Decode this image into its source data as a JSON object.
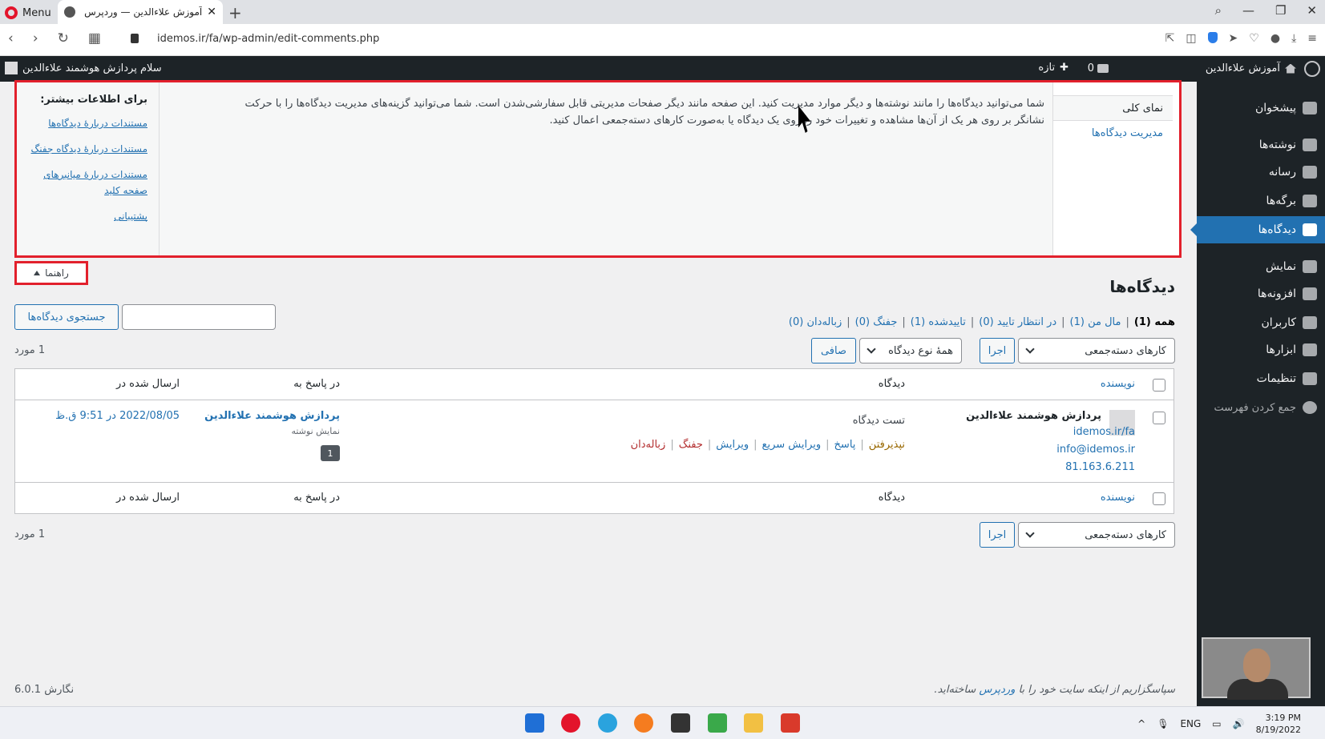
{
  "browser": {
    "menu_label": "Menu",
    "tab_title": "آموزش علاءالدین — وردپرس",
    "url": "idemos.ir/fa/wp-admin/edit-comments.php"
  },
  "adminbar": {
    "site_name": "آموزش علاءالدین",
    "comments_count": "0",
    "new_label": "تازه",
    "howdy": "سلام پردازش هوشمند علاءالدین"
  },
  "sidebar": {
    "items": [
      {
        "label": "پیشخوان",
        "icon": "dashboard-icon"
      },
      {
        "label": "نوشته‌ها",
        "icon": "pin-icon"
      },
      {
        "label": "رسانه",
        "icon": "media-icon"
      },
      {
        "label": "برگه‌ها",
        "icon": "pages-icon"
      },
      {
        "label": "دیدگاه‌ها",
        "icon": "comments-icon",
        "active": true
      },
      {
        "label": "نمایش",
        "icon": "appearance-icon"
      },
      {
        "label": "افزونه‌ها",
        "icon": "plugins-icon"
      },
      {
        "label": "کاربران",
        "icon": "users-icon"
      },
      {
        "label": "ابزارها",
        "icon": "tools-icon"
      },
      {
        "label": "تنظیمات",
        "icon": "settings-icon"
      },
      {
        "label": "جمع کردن فهرست",
        "icon": "collapse-icon"
      }
    ]
  },
  "help": {
    "tab_overview": "نمای کلی",
    "tab_manage": "مدیریت دیدگاه‌ها",
    "content": "شما می‌توانید دیدگاه‌ها را مانند نوشته‌ها و دیگر موارد مدیریت کنید. این صفحه مانند دیگر صفحات مدیریتی قابل سفارشی‌شدن است. شما می‌توانید گزینه‌های مدیریت دیدگاه‌ها را با حرکت نشانگر بر روی هر یک از آن‌ها مشاهده و تغییرات خود را روی یک دیدگاه یا به‌صورت کارهای دسته‌جمعی اعمال کنید.",
    "sidebar_title": "برای اطلاعات بیشتر:",
    "links": [
      "مستندات دربارهٔ دیدگاه‌ها",
      "مستندات دربارهٔ دیدگاه جفنگ",
      "مستندات دربارهٔ میانبرهای صفحه کلید",
      "پشتیبانی"
    ],
    "toggle_label": "راهنما"
  },
  "page": {
    "title": "دیدگاه‌ها",
    "filters": [
      {
        "label": "همه",
        "count": "(1)",
        "current": true
      },
      {
        "label": "مال من",
        "count": "(1)"
      },
      {
        "label": "در انتظار تایید",
        "count": "(0)"
      },
      {
        "label": "تاییدشده",
        "count": "(1)"
      },
      {
        "label": "جفنگ",
        "count": "(0)"
      },
      {
        "label": "زباله‌دان",
        "count": "(0)"
      }
    ],
    "search_button": "جستجوی دیدگاه‌ها",
    "search_placeholder": "",
    "bulk_actions": "کارهای دسته‌جمعی",
    "apply": "اجرا",
    "comment_type": "همهٔ نوع دیدگاه",
    "filter_button": "صافی",
    "items_count": "1 مورد"
  },
  "table": {
    "headers": {
      "author": "نویسنده",
      "comment": "دیدگاه",
      "response": "در پاسخ به",
      "submitted": "ارسال شده در"
    },
    "row": {
      "author_name": "پردازش هوشمند علاءالدین",
      "author_url": "idemos.ir/fa",
      "author_email": "info@idemos.ir",
      "author_ip": "81.163.6.211",
      "comment": "تست دیدگاه",
      "actions": [
        "نپذیرفتن",
        "پاسخ",
        "ویرایش سریع",
        "ویرایش",
        "جفنگ",
        "زباله‌دان"
      ],
      "response_to": "پردازش هوشمند علاءالدین",
      "view_post": "نمایش نوشته",
      "comment_count": "1",
      "submitted_on": "2022/08/05 در 9:51 ق.ظ"
    }
  },
  "footer": {
    "thanks_prefix": "سپاسگزاریم از اینکه سایت خود را با ",
    "thanks_link": "وردپرس",
    "thanks_suffix": " ساخته‌اید.",
    "version": "نگارش 6.0.1"
  },
  "taskbar": {
    "lang": "ENG",
    "time": "3:19 PM",
    "date": "8/19/2022"
  },
  "colors": {
    "admin_dark": "#1d2327",
    "accent": "#2271b1",
    "highlight_box": "#e2202c"
  }
}
